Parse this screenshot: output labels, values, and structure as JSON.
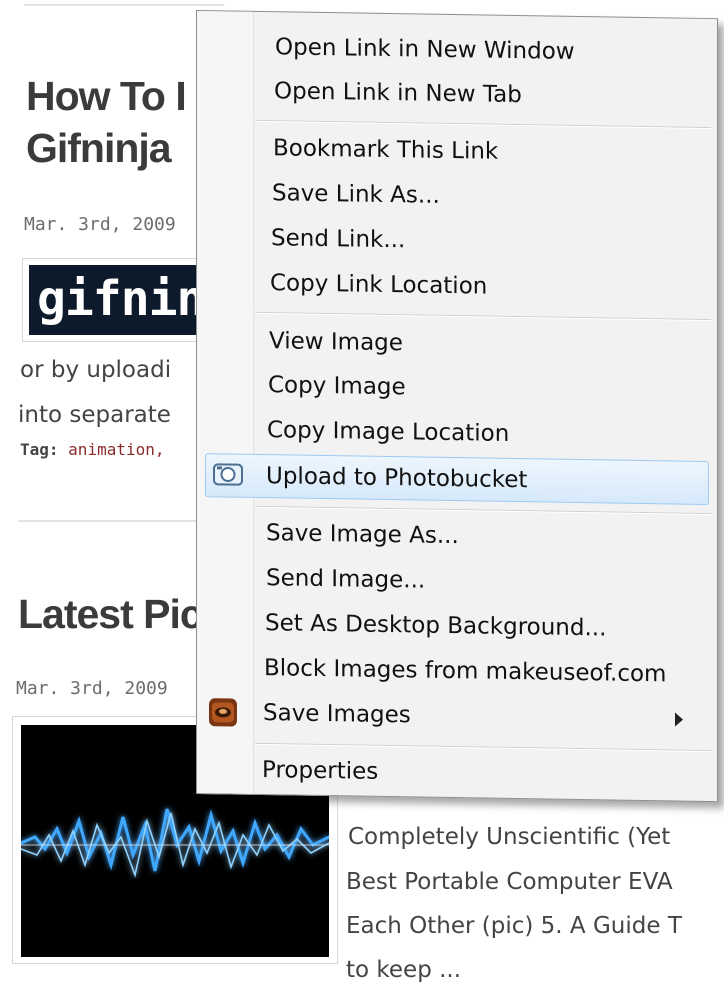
{
  "blog": {
    "post1": {
      "title_line1": "How To I",
      "title_line2": "Gifninja",
      "date": "Mar. 3rd, 2009",
      "logo_text": "gifninja",
      "excerpt_line1": "or by uploadi",
      "excerpt_line2": "into separate",
      "tag_label": "Tag:",
      "tag_value": "animation,"
    },
    "post2": {
      "title": "Latest Pic",
      "date": "Mar. 3rd, 2009",
      "excerpt_lines": [
        "Completely Unscientific (Yet",
        "Best Portable Computer EVA",
        "Each Other (pic) 5. A Guide T",
        "to keep ..."
      ]
    }
  },
  "context_menu": {
    "items": [
      {
        "label": "Open Link in New Window"
      },
      {
        "label": "Open Link in New Tab"
      },
      {
        "label": "Bookmark This Link"
      },
      {
        "label": "Save Link As..."
      },
      {
        "label": "Send Link..."
      },
      {
        "label": "Copy Link Location"
      },
      {
        "label": "View Image"
      },
      {
        "label": "Copy Image"
      },
      {
        "label": "Copy Image Location"
      },
      {
        "label": "Upload to Photobucket",
        "icon": "camera-icon",
        "highlighted": true
      },
      {
        "label": "Save Image As..."
      },
      {
        "label": "Send Image..."
      },
      {
        "label": "Set As Desktop Background..."
      },
      {
        "label": "Block Images from makeuseof.com"
      },
      {
        "label": "Save Images",
        "icon": "extension-icon",
        "has_submenu": true
      },
      {
        "label": "Properties"
      }
    ]
  },
  "colors": {
    "highlight_border": "#9ccaf3",
    "highlight_fill": "#d6e9fb",
    "tag_link": "#8a2a2a",
    "logo_bg": "#0d1a2b"
  }
}
